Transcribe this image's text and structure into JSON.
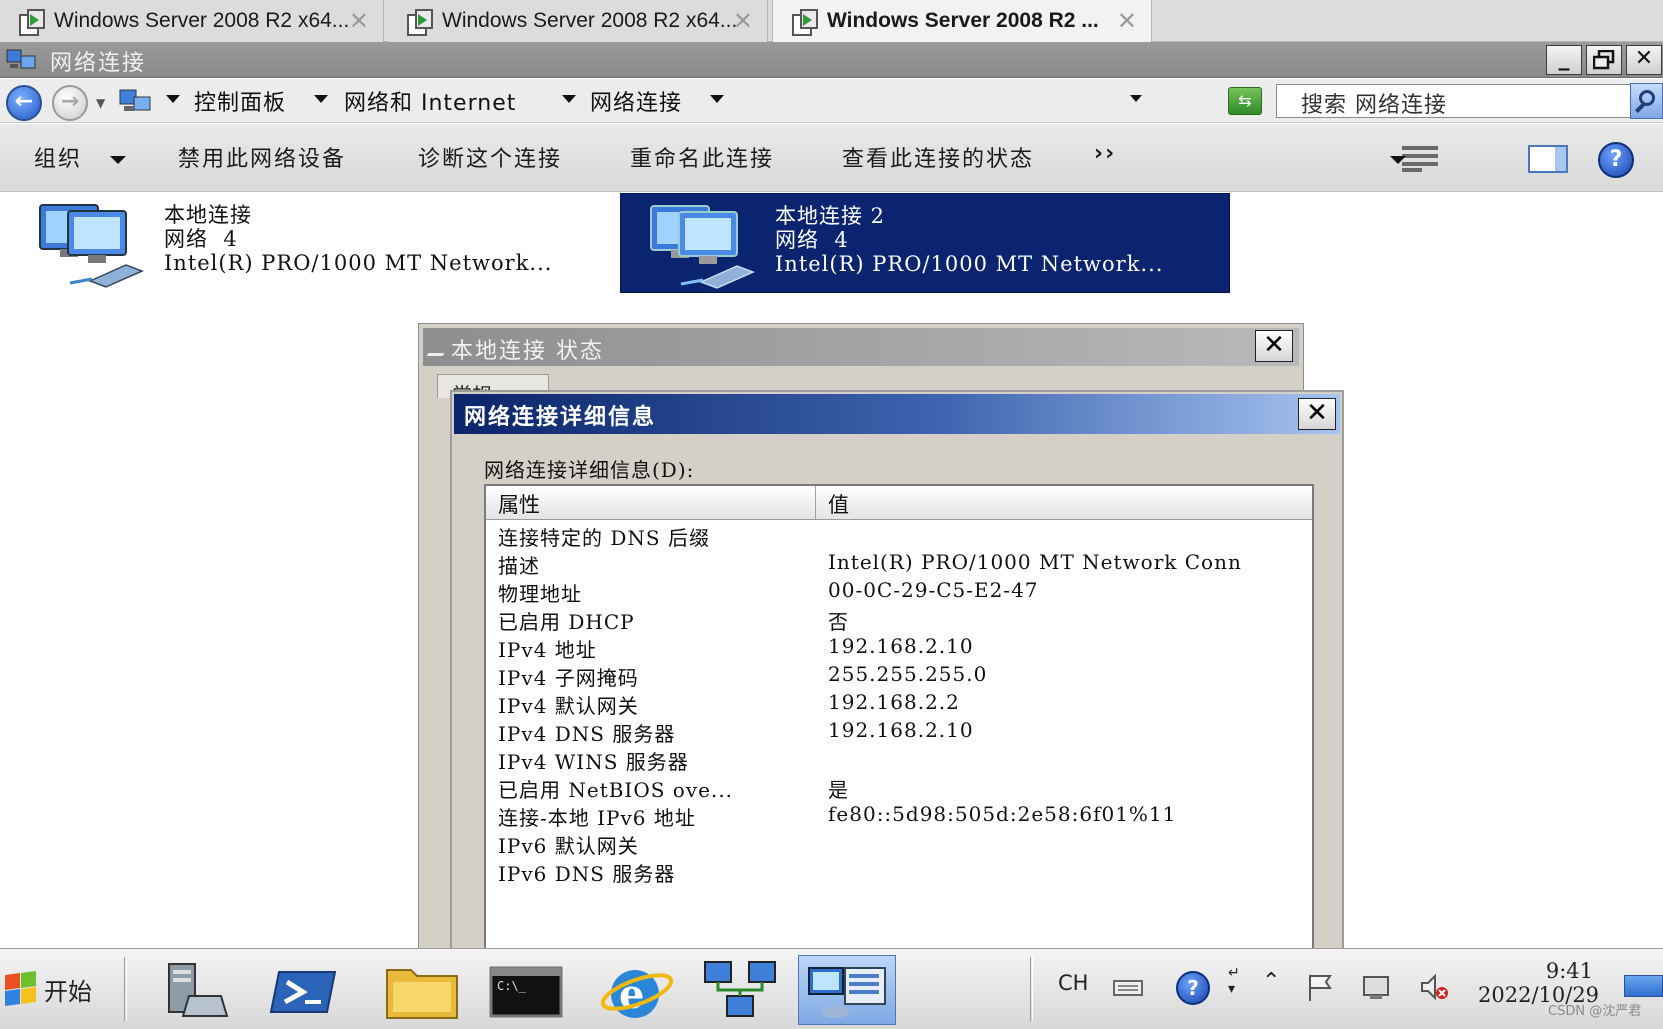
{
  "vm_tabs": [
    {
      "label": "Windows Server 2008 R2 x64...",
      "close": "✕"
    },
    {
      "label": "Windows Server 2008 R2 x64...",
      "close": "✕"
    },
    {
      "label": "Windows Server 2008 R2 ...",
      "close": "✕"
    }
  ],
  "window": {
    "title": "网络连接",
    "minimize": "_",
    "restore": "🗗",
    "close": "✕"
  },
  "address": {
    "crumbs": [
      "控制面板",
      "网络和 Internet",
      "网络连接"
    ],
    "search_placeholder": "搜索 网络连接"
  },
  "commands": {
    "organize": "组织",
    "disable": "禁用此网络设备",
    "diagnose": "诊断这个连接",
    "rename": "重命名此连接",
    "view_status": "查看此连接的状态",
    "more": "››"
  },
  "connections": [
    {
      "name": "本地连接",
      "network": "网络  4",
      "adapter": "Intel(R) PRO/1000 MT Network..."
    },
    {
      "name": "本地连接 2",
      "network": "网络  4",
      "adapter": "Intel(R) PRO/1000 MT Network..."
    }
  ],
  "status_dialog": {
    "title": "本地连接 状态",
    "tab": "常规",
    "close": "✕"
  },
  "details_dialog": {
    "title": "网络连接详细信息",
    "label": "网络连接详细信息(D):",
    "col_property": "属性",
    "col_value": "值",
    "close": "✕",
    "rows": [
      {
        "property": "连接特定的 DNS 后缀",
        "value": ""
      },
      {
        "property": "描述",
        "value": "Intel(R) PRO/1000 MT Network Conn"
      },
      {
        "property": "物理地址",
        "value": "00-0C-29-C5-E2-47"
      },
      {
        "property": "已启用 DHCP",
        "value": "否"
      },
      {
        "property": "IPv4 地址",
        "value": "192.168.2.10"
      },
      {
        "property": "IPv4 子网掩码",
        "value": "255.255.255.0"
      },
      {
        "property": "IPv4 默认网关",
        "value": "192.168.2.2"
      },
      {
        "property": "IPv4 DNS 服务器",
        "value": "192.168.2.10"
      },
      {
        "property": "IPv4 WINS 服务器",
        "value": ""
      },
      {
        "property": "已启用 NetBIOS ove...",
        "value": "是"
      },
      {
        "property": "连接-本地 IPv6 地址",
        "value": "fe80::5d98:505d:2e58:6f01%11"
      },
      {
        "property": "IPv6 默认网关",
        "value": ""
      },
      {
        "property": "IPv6 DNS 服务器",
        "value": ""
      }
    ]
  },
  "taskbar": {
    "start": "开始",
    "lang": "CH",
    "time": "9:41",
    "date": "2022/10/29",
    "watermark": "CSDN @沈严君"
  },
  "colors": {
    "selection": "#0b2470",
    "dialog_title": "#0a2468",
    "dialog_face": "#d4d0c8",
    "taskbar_active": "#7fa9e4"
  }
}
